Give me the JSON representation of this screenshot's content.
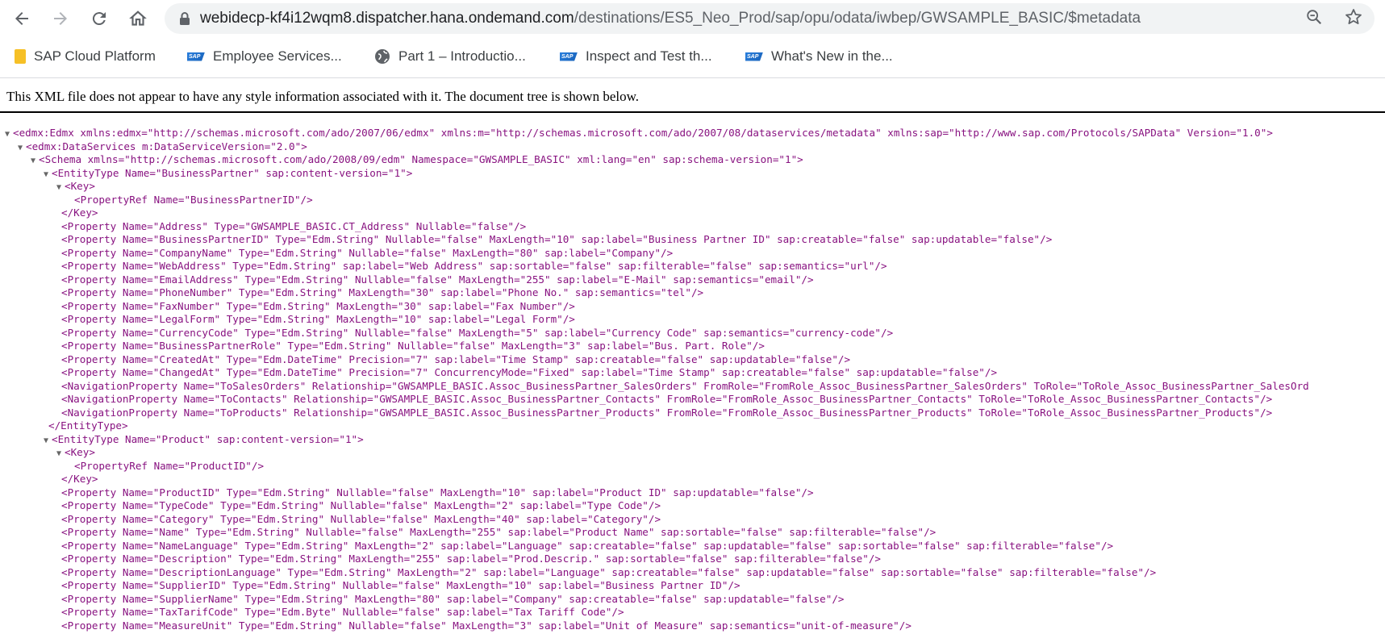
{
  "browser": {
    "url_host": "webidecp-kf4i12wqm8.dispatcher.hana.ondemand.com",
    "url_path": "/destinations/ES5_Neo_Prod/sap/opu/odata/iwbep/GWSAMPLE_BASIC/$metadata",
    "bookmarks": [
      {
        "label": "SAP Cloud Platform",
        "icon": "folder-icon"
      },
      {
        "label": "Employee Services...",
        "icon": "sap-logo-icon"
      },
      {
        "label": "Part 1 – Introductio...",
        "icon": "globe-icon"
      },
      {
        "label": "Inspect and Test th...",
        "icon": "sap-logo-icon"
      },
      {
        "label": "What's New in the...",
        "icon": "sap-logo-icon"
      }
    ]
  },
  "xml": {
    "notice": "This XML file does not appear to have any style information associated with it. The document tree is shown below.",
    "lines": [
      {
        "text": "<edmx:Edmx xmlns:edmx=\"http://schemas.microsoft.com/ado/2007/06/edmx\" xmlns:m=\"http://schemas.microsoft.com/ado/2007/08/dataservices/metadata\" xmlns:sap=\"http://www.sap.com/Protocols/SAPData\" Version=\"1.0\">",
        "indent": 0,
        "toggle": true
      },
      {
        "text": "<edmx:DataServices m:DataServiceVersion=\"2.0\">",
        "indent": 1,
        "toggle": true
      },
      {
        "text": "<Schema xmlns=\"http://schemas.microsoft.com/ado/2008/09/edm\" Namespace=\"GWSAMPLE_BASIC\" xml:lang=\"en\" sap:schema-version=\"1\">",
        "indent": 2,
        "toggle": true
      },
      {
        "text": "<EntityType Name=\"BusinessPartner\" sap:content-version=\"1\">",
        "indent": 3,
        "toggle": true
      },
      {
        "text": "<Key>",
        "indent": 4,
        "toggle": true
      },
      {
        "text": "<PropertyRef Name=\"BusinessPartnerID\"/>",
        "indent": 5,
        "toggle": false
      },
      {
        "text": "</Key>",
        "indent": 4,
        "toggle": false
      },
      {
        "text": "<Property Name=\"Address\" Type=\"GWSAMPLE_BASIC.CT_Address\" Nullable=\"false\"/>",
        "indent": 4,
        "toggle": false
      },
      {
        "text": "<Property Name=\"BusinessPartnerID\" Type=\"Edm.String\" Nullable=\"false\" MaxLength=\"10\" sap:label=\"Business Partner ID\" sap:creatable=\"false\" sap:updatable=\"false\"/>",
        "indent": 4,
        "toggle": false
      },
      {
        "text": "<Property Name=\"CompanyName\" Type=\"Edm.String\" Nullable=\"false\" MaxLength=\"80\" sap:label=\"Company\"/>",
        "indent": 4,
        "toggle": false
      },
      {
        "text": "<Property Name=\"WebAddress\" Type=\"Edm.String\" sap:label=\"Web Address\" sap:sortable=\"false\" sap:filterable=\"false\" sap:semantics=\"url\"/>",
        "indent": 4,
        "toggle": false
      },
      {
        "text": "<Property Name=\"EmailAddress\" Type=\"Edm.String\" Nullable=\"false\" MaxLength=\"255\" sap:label=\"E-Mail\" sap:semantics=\"email\"/>",
        "indent": 4,
        "toggle": false
      },
      {
        "text": "<Property Name=\"PhoneNumber\" Type=\"Edm.String\" MaxLength=\"30\" sap:label=\"Phone No.\" sap:semantics=\"tel\"/>",
        "indent": 4,
        "toggle": false
      },
      {
        "text": "<Property Name=\"FaxNumber\" Type=\"Edm.String\" MaxLength=\"30\" sap:label=\"Fax Number\"/>",
        "indent": 4,
        "toggle": false
      },
      {
        "text": "<Property Name=\"LegalForm\" Type=\"Edm.String\" MaxLength=\"10\" sap:label=\"Legal Form\"/>",
        "indent": 4,
        "toggle": false
      },
      {
        "text": "<Property Name=\"CurrencyCode\" Type=\"Edm.String\" Nullable=\"false\" MaxLength=\"5\" sap:label=\"Currency Code\" sap:semantics=\"currency-code\"/>",
        "indent": 4,
        "toggle": false
      },
      {
        "text": "<Property Name=\"BusinessPartnerRole\" Type=\"Edm.String\" Nullable=\"false\" MaxLength=\"3\" sap:label=\"Bus. Part. Role\"/>",
        "indent": 4,
        "toggle": false
      },
      {
        "text": "<Property Name=\"CreatedAt\" Type=\"Edm.DateTime\" Precision=\"7\" sap:label=\"Time Stamp\" sap:creatable=\"false\" sap:updatable=\"false\"/>",
        "indent": 4,
        "toggle": false
      },
      {
        "text": "<Property Name=\"ChangedAt\" Type=\"Edm.DateTime\" Precision=\"7\" ConcurrencyMode=\"Fixed\" sap:label=\"Time Stamp\" sap:creatable=\"false\" sap:updatable=\"false\"/>",
        "indent": 4,
        "toggle": false
      },
      {
        "text": "<NavigationProperty Name=\"ToSalesOrders\" Relationship=\"GWSAMPLE_BASIC.Assoc_BusinessPartner_SalesOrders\" FromRole=\"FromRole_Assoc_BusinessPartner_SalesOrders\" ToRole=\"ToRole_Assoc_BusinessPartner_SalesOrd",
        "indent": 4,
        "toggle": false
      },
      {
        "text": "<NavigationProperty Name=\"ToContacts\" Relationship=\"GWSAMPLE_BASIC.Assoc_BusinessPartner_Contacts\" FromRole=\"FromRole_Assoc_BusinessPartner_Contacts\" ToRole=\"ToRole_Assoc_BusinessPartner_Contacts\"/>",
        "indent": 4,
        "toggle": false
      },
      {
        "text": "<NavigationProperty Name=\"ToProducts\" Relationship=\"GWSAMPLE_BASIC.Assoc_BusinessPartner_Products\" FromRole=\"FromRole_Assoc_BusinessPartner_Products\" ToRole=\"ToRole_Assoc_BusinessPartner_Products\"/>",
        "indent": 4,
        "toggle": false
      },
      {
        "text": "</EntityType>",
        "indent": 3,
        "toggle": false
      },
      {
        "text": "<EntityType Name=\"Product\" sap:content-version=\"1\">",
        "indent": 3,
        "toggle": true
      },
      {
        "text": "<Key>",
        "indent": 4,
        "toggle": true
      },
      {
        "text": "<PropertyRef Name=\"ProductID\"/>",
        "indent": 5,
        "toggle": false
      },
      {
        "text": "</Key>",
        "indent": 4,
        "toggle": false
      },
      {
        "text": "<Property Name=\"ProductID\" Type=\"Edm.String\" Nullable=\"false\" MaxLength=\"10\" sap:label=\"Product ID\" sap:updatable=\"false\"/>",
        "indent": 4,
        "toggle": false
      },
      {
        "text": "<Property Name=\"TypeCode\" Type=\"Edm.String\" Nullable=\"false\" MaxLength=\"2\" sap:label=\"Type Code\"/>",
        "indent": 4,
        "toggle": false
      },
      {
        "text": "<Property Name=\"Category\" Type=\"Edm.String\" Nullable=\"false\" MaxLength=\"40\" sap:label=\"Category\"/>",
        "indent": 4,
        "toggle": false
      },
      {
        "text": "<Property Name=\"Name\" Type=\"Edm.String\" Nullable=\"false\" MaxLength=\"255\" sap:label=\"Product Name\" sap:sortable=\"false\" sap:filterable=\"false\"/>",
        "indent": 4,
        "toggle": false
      },
      {
        "text": "<Property Name=\"NameLanguage\" Type=\"Edm.String\" MaxLength=\"2\" sap:label=\"Language\" sap:creatable=\"false\" sap:updatable=\"false\" sap:sortable=\"false\" sap:filterable=\"false\"/>",
        "indent": 4,
        "toggle": false
      },
      {
        "text": "<Property Name=\"Description\" Type=\"Edm.String\" MaxLength=\"255\" sap:label=\"Prod.Descrip.\" sap:sortable=\"false\" sap:filterable=\"false\"/>",
        "indent": 4,
        "toggle": false
      },
      {
        "text": "<Property Name=\"DescriptionLanguage\" Type=\"Edm.String\" MaxLength=\"2\" sap:label=\"Language\" sap:creatable=\"false\" sap:updatable=\"false\" sap:sortable=\"false\" sap:filterable=\"false\"/>",
        "indent": 4,
        "toggle": false
      },
      {
        "text": "<Property Name=\"SupplierID\" Type=\"Edm.String\" Nullable=\"false\" MaxLength=\"10\" sap:label=\"Business Partner ID\"/>",
        "indent": 4,
        "toggle": false
      },
      {
        "text": "<Property Name=\"SupplierName\" Type=\"Edm.String\" MaxLength=\"80\" sap:label=\"Company\" sap:creatable=\"false\" sap:updatable=\"false\"/>",
        "indent": 4,
        "toggle": false
      },
      {
        "text": "<Property Name=\"TaxTarifCode\" Type=\"Edm.Byte\" Nullable=\"false\" sap:label=\"Tax Tariff Code\"/>",
        "indent": 4,
        "toggle": false
      },
      {
        "text": "<Property Name=\"MeasureUnit\" Type=\"Edm.String\" Nullable=\"false\" MaxLength=\"3\" sap:label=\"Unit of Measure\" sap:semantics=\"unit-of-measure\"/>",
        "indent": 4,
        "toggle": false
      }
    ]
  }
}
